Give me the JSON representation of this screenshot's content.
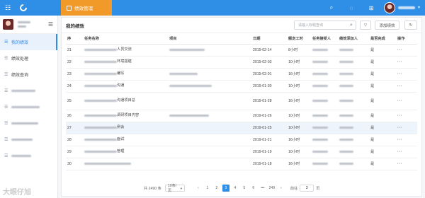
{
  "topbar": {
    "app_tab_label": "绩效管理",
    "accent_color": "#2f8fe6",
    "tab_color": "#f19a2a"
  },
  "sidebar": {
    "items": [
      {
        "label": "我的绩效",
        "active": true
      },
      {
        "label": "绩效处理",
        "active": false
      },
      {
        "label": "绩效查询",
        "active": false
      },
      {
        "label": "",
        "active": false
      },
      {
        "label": "",
        "active": false
      },
      {
        "label": "",
        "active": false
      },
      {
        "label": "",
        "active": false
      },
      {
        "label": "",
        "active": false
      }
    ]
  },
  "main": {
    "title": "我的绩效",
    "search_placeholder": "请输入标题查询",
    "add_label": "添加绩效"
  },
  "table": {
    "headers": [
      "序",
      "任务名称",
      "项目",
      "日期",
      "额定工时",
      "任务接受人",
      "绩效添加人",
      "是否完成",
      "操作"
    ],
    "rows": [
      {
        "no": "21",
        "name": "人员交流",
        "date": "2019-02-14",
        "hours": "8小时",
        "done": "是"
      },
      {
        "no": "22",
        "name": "环境搭建",
        "date": "2019-02-03",
        "hours": "10小时",
        "done": "是"
      },
      {
        "no": "23",
        "name": "编写",
        "date": "2019-02-01",
        "hours": "16小时",
        "done": "是"
      },
      {
        "no": "24",
        "name": "沟通",
        "date": "2019-01-30",
        "hours": "10小时",
        "done": "是"
      },
      {
        "no": "25",
        "name": "沟通项目总",
        "date": "2019-01-28",
        "hours": "16小时",
        "done": "是"
      },
      {
        "no": "26",
        "name": "调研项目内容",
        "date": "2019-01-26",
        "hours": "10小时",
        "done": "是"
      },
      {
        "no": "27",
        "name": "例会",
        "date": "2019-01-25",
        "hours": "10小时",
        "done": "是"
      },
      {
        "no": "28",
        "name": "面试",
        "date": "2019-01-21",
        "hours": "16小时",
        "done": "是"
      },
      {
        "no": "29",
        "name": "管理",
        "date": "2019-01-19",
        "hours": "10小时",
        "done": "是"
      },
      {
        "no": "30",
        "name": "",
        "date": "2019-01-18",
        "hours": "16小时",
        "done": "是"
      }
    ],
    "more_label": "···"
  },
  "pager": {
    "total": "共 2490 条",
    "page_size": "10条/页",
    "pages": [
      "1",
      "2",
      "3",
      "4",
      "5",
      "6",
      "•••",
      "249"
    ],
    "current_page": "3",
    "prev": "‹",
    "next": "›",
    "goto_label": "前往",
    "goto_value": "3",
    "goto_suffix": "页"
  },
  "watermark": "大眼仔旭"
}
